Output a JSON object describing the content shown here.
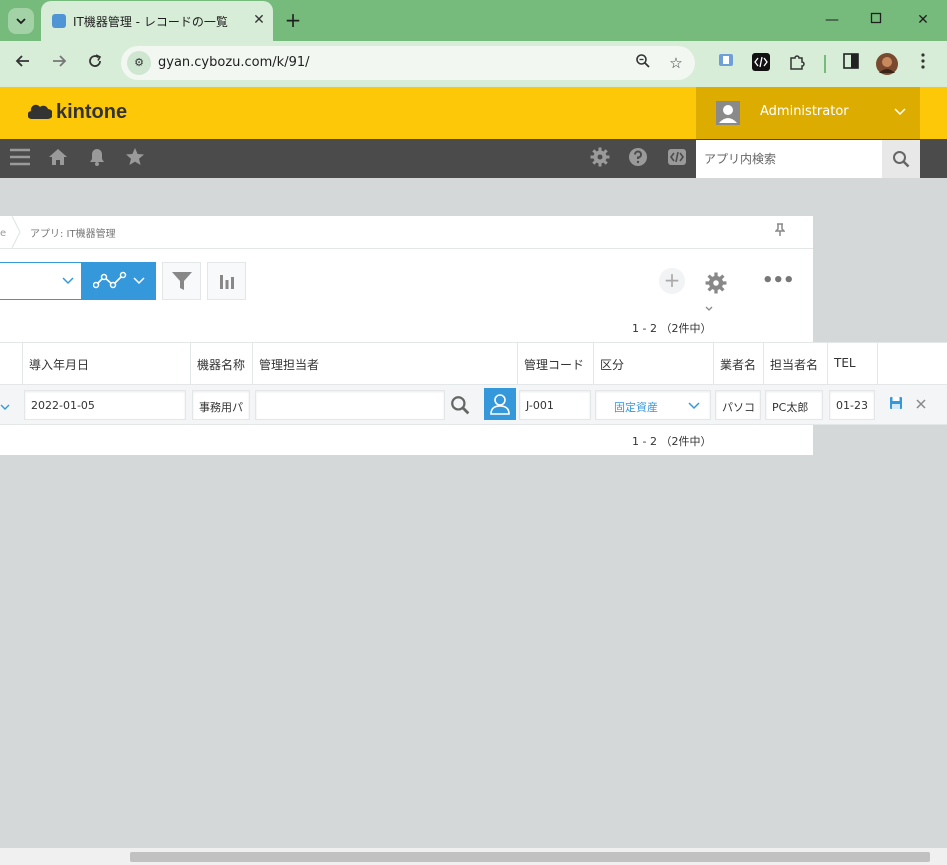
{
  "browser": {
    "tab_title": "IT機器管理 - レコードの一覧",
    "url": "gyan.cybozu.com/k/91/",
    "new_tab_label": "+"
  },
  "kintone": {
    "logo_text": "kintone",
    "user_name": "Administrator",
    "search_placeholder": "アプリ内検索"
  },
  "breadcrumb": {
    "app_label": "アプリ: IT機器管理"
  },
  "pager": {
    "top": "1 - 2 （2件中）",
    "bottom": "1 - 2 （2件中）"
  },
  "table": {
    "columns": [
      "導入年月日",
      "機器名称",
      "管理担当者",
      "管理コード",
      "区分",
      "業者名",
      "担当者名",
      "TEL"
    ],
    "row": {
      "date": "2022-01-05",
      "device_name": "事務用パ",
      "manager": "",
      "code": "J-001",
      "category": "固定資産",
      "vendor": "パソコ",
      "contact": "PC太郎",
      "tel": "01-23"
    }
  },
  "colors": {
    "header_yellow": "#fdc808",
    "user_box": "#dcad00",
    "nav_dark": "#4b4b4b",
    "accent_blue": "#3498db",
    "browser_green": "#76bb7c"
  }
}
